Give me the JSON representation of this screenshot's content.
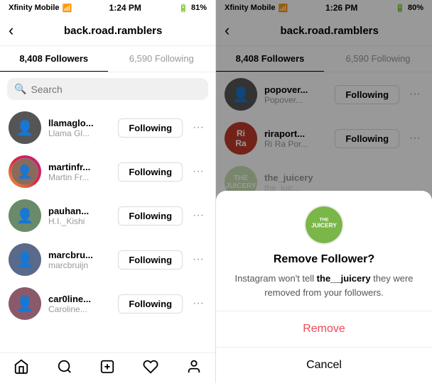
{
  "left": {
    "status_time": "1:24 PM",
    "carrier": "Xfinity Mobile",
    "battery": "81%",
    "header_title": "back.road.ramblers",
    "followers_tab": "8,408 Followers",
    "following_tab": "6,590 Following",
    "search_placeholder": "Search",
    "users": [
      {
        "username": "llamaglo...",
        "display": "Llama Gl...",
        "has_story": false,
        "av_class": "av1"
      },
      {
        "username": "martinfr...",
        "display": "Martin Fr...",
        "has_story": true,
        "av_class": "av2"
      },
      {
        "username": "pauhan...",
        "display": "H.I._Kishi",
        "has_story": false,
        "av_class": "av3"
      },
      {
        "username": "marcbru...",
        "display": "marcbruijn",
        "has_story": false,
        "av_class": "av4"
      },
      {
        "username": "car0line...",
        "display": "Caroline...",
        "has_story": false,
        "av_class": "av5"
      }
    ],
    "following_label": "Following",
    "nav": [
      "home",
      "search",
      "add",
      "heart",
      "profile"
    ]
  },
  "right": {
    "status_time": "1:26 PM",
    "carrier": "Xfinity Mobile",
    "battery": "80%",
    "header_title": "back.road.ramblers",
    "followers_tab": "8,408 Followers",
    "following_tab": "6,590 Following",
    "users": [
      {
        "username": "popover...",
        "display": "Popover...",
        "av_class": "av1"
      },
      {
        "username": "riraport...",
        "display": "Ri Ra Por...",
        "av_class": "av2"
      },
      {
        "username": "the_juicery",
        "display": "the_juic...",
        "av_class": "av3"
      }
    ],
    "following_label": "Following",
    "modal": {
      "title": "Remove Follower?",
      "body_prefix": "Instagram won't tell ",
      "body_username": "the__juicery",
      "body_suffix": " they were removed from your followers.",
      "remove_label": "Remove",
      "cancel_label": "Cancel",
      "logo_text": "THE JUICERY"
    }
  }
}
